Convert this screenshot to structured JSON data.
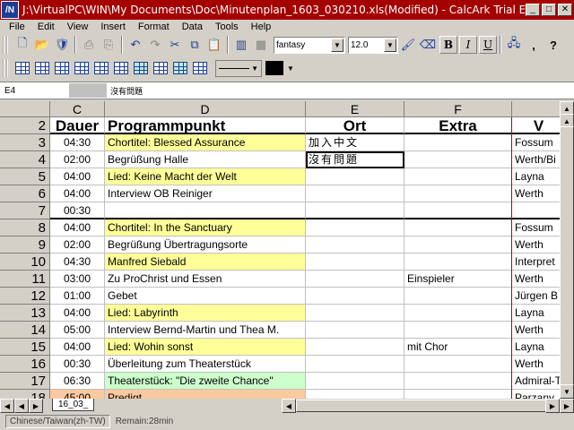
{
  "window": {
    "title": "J:\\VirtualPC\\WIN\\My Documents\\Doc\\Minutenplan_1603_030210.xls(Modified) - CalcArk Trial Edit",
    "app_icon_text": "/N"
  },
  "menu": [
    "File",
    "Edit",
    "View",
    "Insert",
    "Format",
    "Data",
    "Tools",
    "Help"
  ],
  "toolbar": {
    "font_name": "fantasy",
    "font_size": "12.0",
    "bold_label": "B",
    "italic_label": "I",
    "underline_label": "U",
    "help_label": "?",
    "comma_label": ","
  },
  "formula_bar": {
    "cell_ref": "E4",
    "content": "沒有問題"
  },
  "columns": [
    {
      "letter": "C",
      "header": "Dauer"
    },
    {
      "letter": "D",
      "header": "Programmpunkt"
    },
    {
      "letter": "E",
      "header": "Ort"
    },
    {
      "letter": "F",
      "header": "Extra"
    },
    {
      "letter": "G",
      "header": "V"
    }
  ],
  "rows": [
    {
      "num": "2",
      "dauer": "Dauer",
      "punkt": "Programmpunkt",
      "ort": "Ort",
      "extra": "Extra",
      "v": "V"
    },
    {
      "num": "3",
      "dauer": "04:30",
      "punkt": "Chortitel: Blessed Assurance",
      "ort": "加入中文",
      "extra": "",
      "v": "Fossum",
      "color": "yellow"
    },
    {
      "num": "4",
      "dauer": "02:00",
      "punkt": "Begrüßung Halle",
      "ort": "沒有問題",
      "extra": "",
      "v": "Werth/Bi"
    },
    {
      "num": "5",
      "dauer": "04:00",
      "punkt": "Lied: Keine Macht der Welt",
      "ort": "",
      "extra": "",
      "v": "Layna",
      "color": "yellow"
    },
    {
      "num": "6",
      "dauer": "04:00",
      "punkt": "Interview OB Reiniger",
      "ort": "",
      "extra": "",
      "v": "Werth"
    },
    {
      "num": "7",
      "dauer": "00:30",
      "punkt": "",
      "ort": "",
      "extra": "",
      "v": ""
    },
    {
      "num": "8",
      "dauer": "04:00",
      "punkt": "Chortitel: In the Sanctuary",
      "ort": "",
      "extra": "",
      "v": "Fossum",
      "color": "yellow"
    },
    {
      "num": "9",
      "dauer": "02:00",
      "punkt": "Begrüßung Übertragungsorte",
      "ort": "",
      "extra": "",
      "v": "Werth"
    },
    {
      "num": "10",
      "dauer": "04:30",
      "punkt": "Manfred Siebald",
      "ort": "",
      "extra": "",
      "v": "Interpret",
      "color": "yellow"
    },
    {
      "num": "11",
      "dauer": "03:00",
      "punkt": "Zu ProChrist und Essen",
      "ort": "",
      "extra": "Einspieler",
      "v": "Werth"
    },
    {
      "num": "12",
      "dauer": "01:00",
      "punkt": "Gebet",
      "ort": "",
      "extra": "",
      "v": "Jürgen B"
    },
    {
      "num": "13",
      "dauer": "04:00",
      "punkt": "Lied: Labyrinth",
      "ort": "",
      "extra": "",
      "v": "Layna",
      "color": "yellow"
    },
    {
      "num": "14",
      "dauer": "05:00",
      "punkt": "Interview Bernd-Martin und Thea M.",
      "ort": "",
      "extra": "",
      "v": "Werth"
    },
    {
      "num": "15",
      "dauer": "04:00",
      "punkt": "Lied: Wohin sonst",
      "ort": "",
      "extra": "mit Chor",
      "v": "Layna",
      "color": "yellow"
    },
    {
      "num": "16",
      "dauer": "00:30",
      "punkt": "Überleitung zum Theaterstück",
      "ort": "",
      "extra": "",
      "v": "Werth"
    },
    {
      "num": "17",
      "dauer": "06:30",
      "punkt": "Theaterstück: \"Die zweite Chance\"",
      "ort": "",
      "extra": "",
      "v": "Admiral-T",
      "color": "green"
    },
    {
      "num": "18",
      "dauer": "45:00",
      "punkt": "Predigt",
      "ort": "",
      "extra": "",
      "v": "Parzany",
      "color": "orange"
    }
  ],
  "sheet_tab": "16_03_",
  "status": {
    "language": "Chinese/Taiwan(zh-TW)",
    "remain": "Remain:28min"
  },
  "colors": {
    "titlebar": "#a40000",
    "yellow_row": "#ffff99",
    "green_row": "#ccffcc",
    "orange_row": "#f9c9a0"
  }
}
